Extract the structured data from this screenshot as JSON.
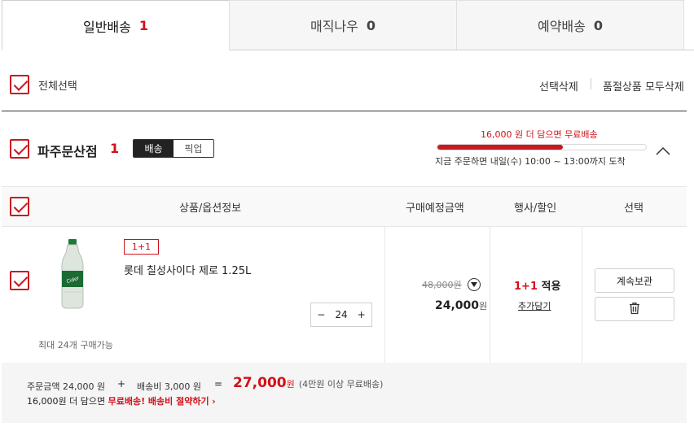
{
  "tabs": [
    {
      "label": "일반배송",
      "count": "1"
    },
    {
      "label": "매직나우",
      "count": "0"
    },
    {
      "label": "예약배송",
      "count": "0"
    }
  ],
  "toolbar": {
    "select_all": "전체선택",
    "delete_selected": "선택삭제",
    "delete_soldout": "품절상품 모두삭제"
  },
  "store": {
    "name": "파주문산점",
    "count": "1",
    "mode_delivery": "배송",
    "mode_pickup": "픽업",
    "free_ship_msg_amount": "16,000 원 더 담으면 ",
    "free_ship_msg_label": "무료배송",
    "free_ship_progress": 0.6,
    "arrival_note": "지금 주문하면 내일(수) 10:00 ~ 13:00까지 도착"
  },
  "table": {
    "headers": [
      "상품/옵션정보",
      "구매예정금액",
      "행사/할인",
      "선택"
    ]
  },
  "item": {
    "badge": "1+1",
    "name": "롯데 칠성사이다 제로 1.25L",
    "limit": "최대 24개 구매가능",
    "quantity": "24",
    "original_price": "48,000원",
    "price": "24,000",
    "price_unit": "원",
    "promo": "1+1",
    "promo_suffix": " 적용",
    "add_more": "추가담기",
    "keep_button": "계속보관"
  },
  "summary": {
    "order_label": "주문금액 24,000 원",
    "plus": "+",
    "shipping_label": "배송비 3,000 원",
    "equals": "=",
    "total": "27,000",
    "total_unit": "원",
    "total_note": "(4만원 이상 무료배송)",
    "hint_prefix": "16,000원 더 담으면 ",
    "hint_highlight": "무료배송! 배송비 절약하기",
    "hint_arrow": "›"
  },
  "colors": {
    "accent": "#d0111b"
  }
}
